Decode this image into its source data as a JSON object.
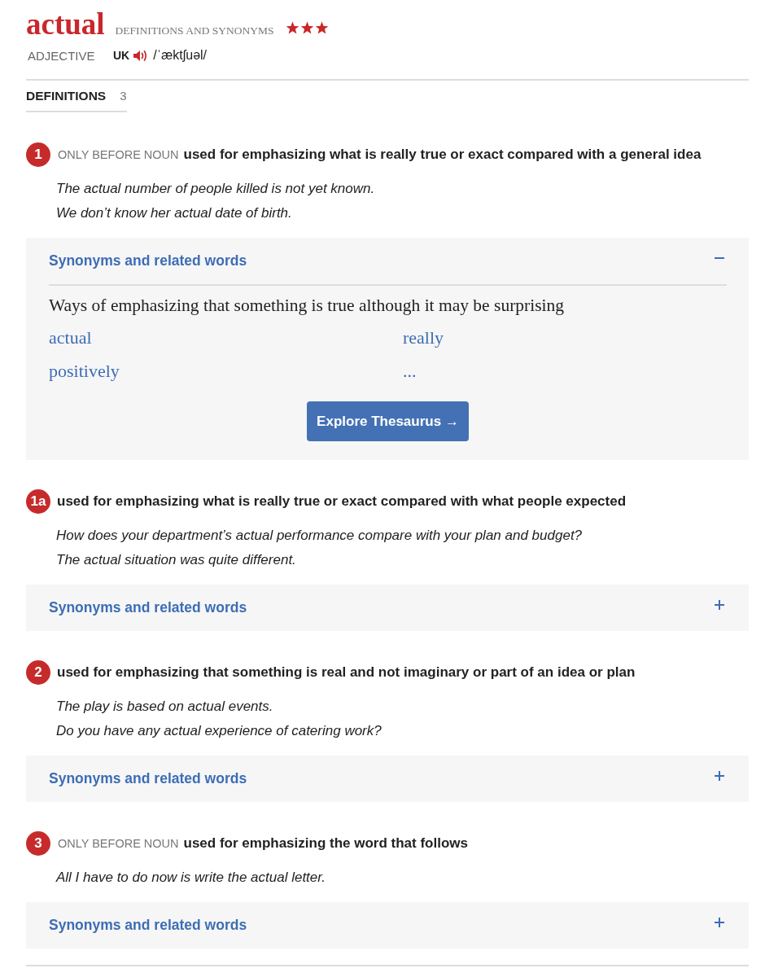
{
  "entry": {
    "headword": "actual",
    "subtitle": "DEFINITIONS AND SYNONYMS",
    "stars": 3,
    "part_of_speech": "ADJECTIVE",
    "region": "UK",
    "pronunciation": "/ˈæktʃuəl/"
  },
  "tabs": [
    {
      "label": "DEFINITIONS",
      "count": "3",
      "selected": true
    }
  ],
  "senses": [
    {
      "number": "1",
      "grammar": "ONLY BEFORE NOUN",
      "definition": "used for emphasizing what is really true or exact compared with a general idea",
      "examples": [
        "The actual number of people killed is not yet known.",
        "We don’t know her actual date of birth."
      ],
      "synonyms": {
        "label": "Synonyms and related words",
        "expanded": true,
        "heading": "Ways of emphasizing that something is true although it may be surprising",
        "words": [
          "actual",
          "really",
          "positively",
          "..."
        ],
        "button": "Explore Thesaurus →"
      }
    },
    {
      "number": "1a",
      "definition": "used for emphasizing what is really true or exact compared with what people expected",
      "examples": [
        "How does your department’s actual performance compare with your plan and budget?",
        "The actual situation was quite different."
      ],
      "synonyms": {
        "label": "Synonyms and related words",
        "expanded": false
      }
    },
    {
      "number": "2",
      "definition": "used for emphasizing that something is real and not imaginary or part of an idea or plan",
      "examples": [
        "The play is based on actual events.",
        "Do you have any actual experience of catering work?"
      ],
      "synonyms": {
        "label": "Synonyms and related words",
        "expanded": false
      }
    },
    {
      "number": "3",
      "grammar": "ONLY BEFORE NOUN",
      "definition": "used for emphasizing the word that follows",
      "examples": [
        "All I have to do now is write the actual letter."
      ],
      "synonyms": {
        "label": "Synonyms and related words",
        "expanded": false
      }
    }
  ]
}
